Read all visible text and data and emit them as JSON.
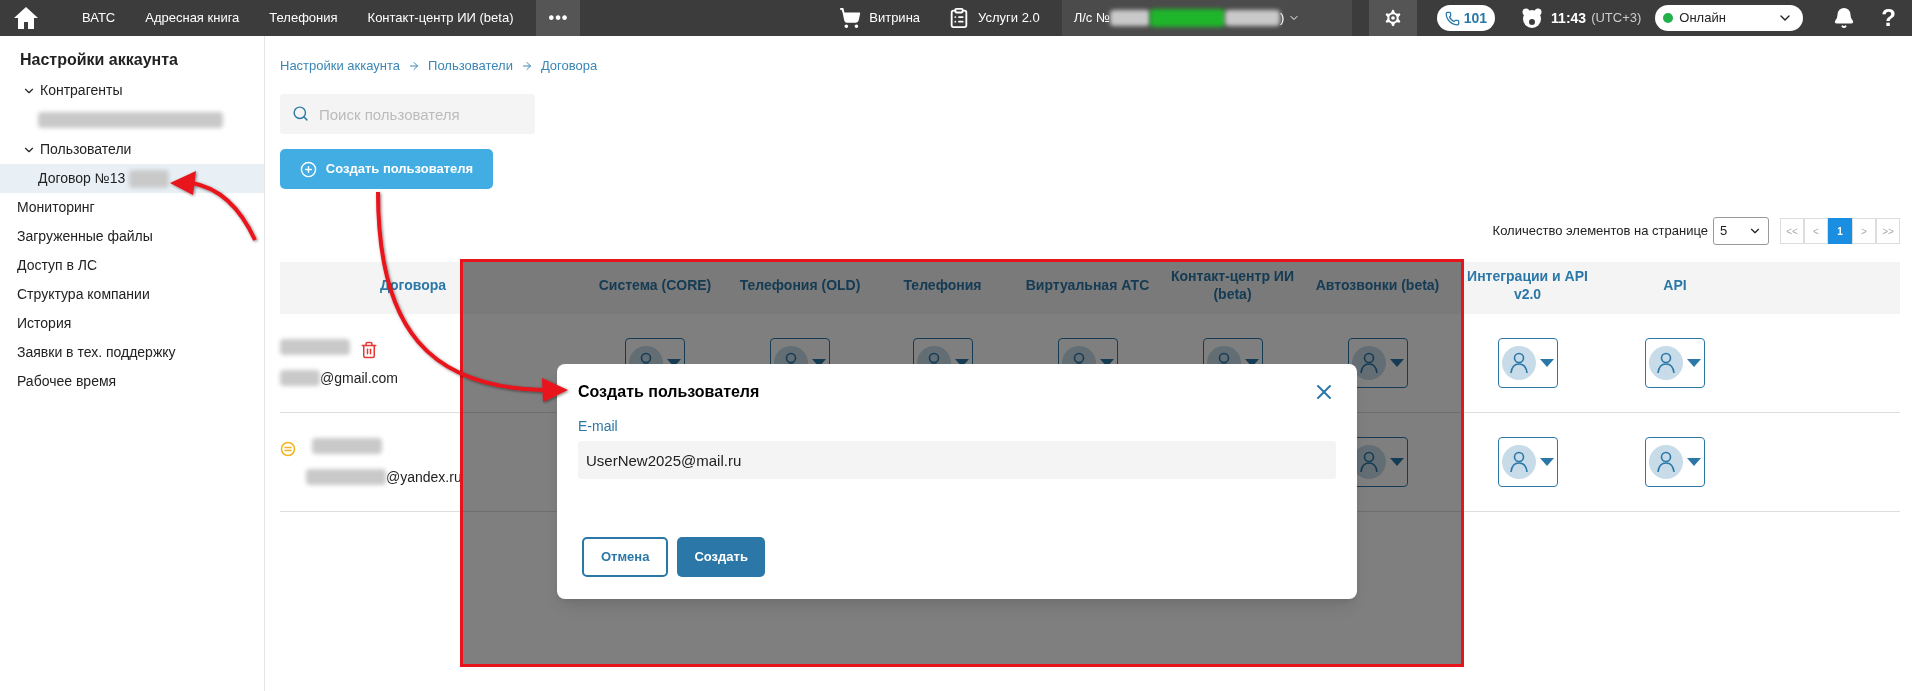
{
  "top_bar": {
    "nav": [
      {
        "label": "ВАТС"
      },
      {
        "label": "Адресная книга"
      },
      {
        "label": "Телефония"
      },
      {
        "label": "Контакт-центр ИИ (beta)"
      }
    ],
    "more": "•••",
    "shop": "Витрина",
    "services": "Услуги 2.0",
    "account": {
      "prefix": "Л/с №",
      "suffix": ")"
    },
    "phone": "101",
    "time": "11:43",
    "timezone": "(UTC+3)",
    "status": {
      "label": "Онлайн",
      "color": "#22b14c"
    },
    "help": "?"
  },
  "sidebar": {
    "title": "Настройки аккаунта",
    "items": [
      {
        "kind": "group",
        "label": "Контрагенты",
        "expanded": true,
        "selected": false,
        "children": [
          {
            "kind": "redacted",
            "selected": false
          }
        ]
      },
      {
        "kind": "group",
        "label": "Пользователи",
        "expanded": true,
        "selected": false,
        "children": [
          {
            "kind": "partly_redacted",
            "label": "Договор №13",
            "selected": true
          }
        ]
      },
      {
        "kind": "link",
        "label": "Мониторинг",
        "selected": false
      },
      {
        "kind": "link",
        "label": "Загруженные файлы",
        "selected": false
      },
      {
        "kind": "link",
        "label": "Доступ в ЛС",
        "selected": false
      },
      {
        "kind": "link",
        "label": "Структура компании",
        "selected": false
      },
      {
        "kind": "link",
        "label": "История",
        "selected": false
      },
      {
        "kind": "link",
        "label": "Заявки в тех. поддержку",
        "selected": false
      },
      {
        "kind": "link",
        "label": "Рабочее время",
        "selected": false
      }
    ]
  },
  "breadcrumb": [
    "Настройки аккаунта",
    "Пользователи",
    "Договора"
  ],
  "search": {
    "placeholder": "Поиск пользователя"
  },
  "create_button": "Создать пользователя",
  "pagination": {
    "label": "Количество элементов на странице",
    "page_size": "5",
    "pages": [
      {
        "label": "<<",
        "selected": false
      },
      {
        "label": "<",
        "selected": false
      },
      {
        "label": "1",
        "selected": true
      },
      {
        "label": ">",
        "selected": false
      },
      {
        "label": ">>",
        "selected": false
      }
    ]
  },
  "table": {
    "columns": [
      "Договора",
      "Система (CORE)",
      "Телефония (OLD)",
      "Телефония",
      "Виртуальная АТС",
      "Контакт-центр ИИ (beta)",
      "Автозвонки (beta)",
      "Интеграции и API v2.0",
      "API"
    ],
    "rows": [
      {
        "kind": "deletable",
        "email": "@gmail.com"
      },
      {
        "kind": "pending",
        "email": "@yandex.ru"
      }
    ]
  },
  "modal": {
    "title": "Создать пользователя",
    "field_label": "E-mail",
    "value": "UserNew2025@mail.ru",
    "buttons": [
      {
        "kind": "secondary",
        "label": "Отмена"
      },
      {
        "kind": "primary",
        "label": "Создать"
      }
    ]
  }
}
